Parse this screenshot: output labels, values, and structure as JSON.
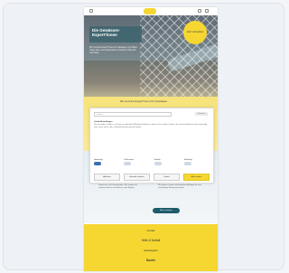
{
  "hero": {
    "title": "Die Gewässer-\nExpert*innen",
    "text": "Wir sind die Expert*innen für Gewässer und Natur. Unser Ziel: eine lebenswerte Umwelt für Mensch und Natur.",
    "badge": "Jetzt mitmachen"
  },
  "section": {
    "title": "Wir sind die Expert*innen für Gewässer"
  },
  "cookie": {
    "search_placeholder": "Suchen",
    "logo_text": "Emscher",
    "heading": "Cookie-Einstellungen",
    "body": "Wir verwenden Cookies, um Ihnen ein optimales Webseiten-Erlebnis zu bieten. Dazu zählen Cookies, die für den Betrieb der Seite notwendig sind, sowie solche, die zu Statistikzwecken genutzt werden.",
    "options": [
      {
        "label": "Notwendig",
        "on": true
      },
      {
        "label": "Präferenzen",
        "on": false
      },
      {
        "label": "Statistik",
        "on": false
      },
      {
        "label": "Marketing",
        "on": false
      }
    ],
    "buttons": {
      "deny": "Ablehnen",
      "selection": "Auswahl erlauben",
      "details": "Details",
      "accept": "Alle erlauben"
    }
  },
  "content": {
    "col_left": "Gewässer sind Lebensadern. Wir sorgen für saubere Flüsse und Bäche in der Region.",
    "col_right": "Wir planen, bauen und betreiben Anlagen für eine nachhaltige Wasserwirtschaft.",
    "button": "Mehr erfahren"
  },
  "footer": {
    "line1": "Kontakt",
    "line2": "Hilfe & Notfall",
    "line3": "Hinweisgeber",
    "line4": "Suche"
  },
  "colors": {
    "accent": "#f6d732",
    "teal": "#1f5b6b"
  }
}
